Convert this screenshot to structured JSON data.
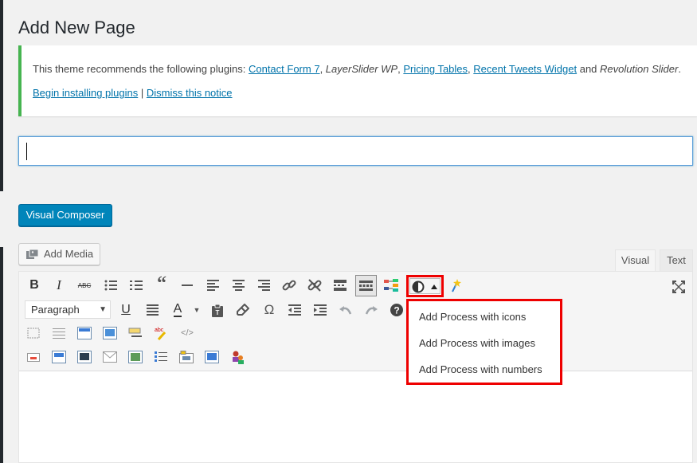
{
  "page": {
    "title": "Add New Page"
  },
  "notice": {
    "intro": "This theme recommends the following plugins: ",
    "plugins": [
      "Contact Form 7",
      "LayerSlider WP",
      "Pricing Tables",
      "Recent Tweets Widget",
      "Revolution Slider"
    ],
    "sep1": ", ",
    "sep2": ", ",
    "sep3": ", ",
    "and": " and ",
    "end": ".",
    "begin_link": "Begin installing plugins",
    "pipe": " | ",
    "dismiss_link": "Dismiss this notice"
  },
  "title_field": {
    "value": "",
    "placeholder": ""
  },
  "buttons": {
    "visual_composer": "Visual Composer",
    "add_media": "Add Media"
  },
  "tabs": {
    "visual": "Visual",
    "text": "Text"
  },
  "toolbar": {
    "format_select": "Paragraph",
    "icons": [
      "bold-icon",
      "italic-icon",
      "strikethrough-icon",
      "bullet-list-icon",
      "numbered-list-icon",
      "blockquote-icon",
      "horizontal-rule-icon",
      "align-left-icon",
      "align-center-icon",
      "align-right-icon",
      "link-icon",
      "unlink-icon",
      "read-more-icon",
      "toolbar-toggle-icon",
      "layout-icon",
      "process-icon",
      "wand-icon",
      "fullscreen-icon",
      "underline-icon",
      "justify-icon",
      "text-color-icon",
      "paste-text-icon",
      "clear-format-icon",
      "special-char-icon",
      "outdent-icon",
      "indent-icon",
      "undo-icon",
      "redo-icon",
      "help-icon"
    ]
  },
  "process_dropdown": {
    "items": [
      "Add Process with icons",
      "Add Process with images",
      "Add Process with numbers"
    ]
  },
  "colors": {
    "accent": "#0085ba",
    "notice_border": "#46b450",
    "highlight": "#e00000",
    "link": "#0073aa"
  }
}
